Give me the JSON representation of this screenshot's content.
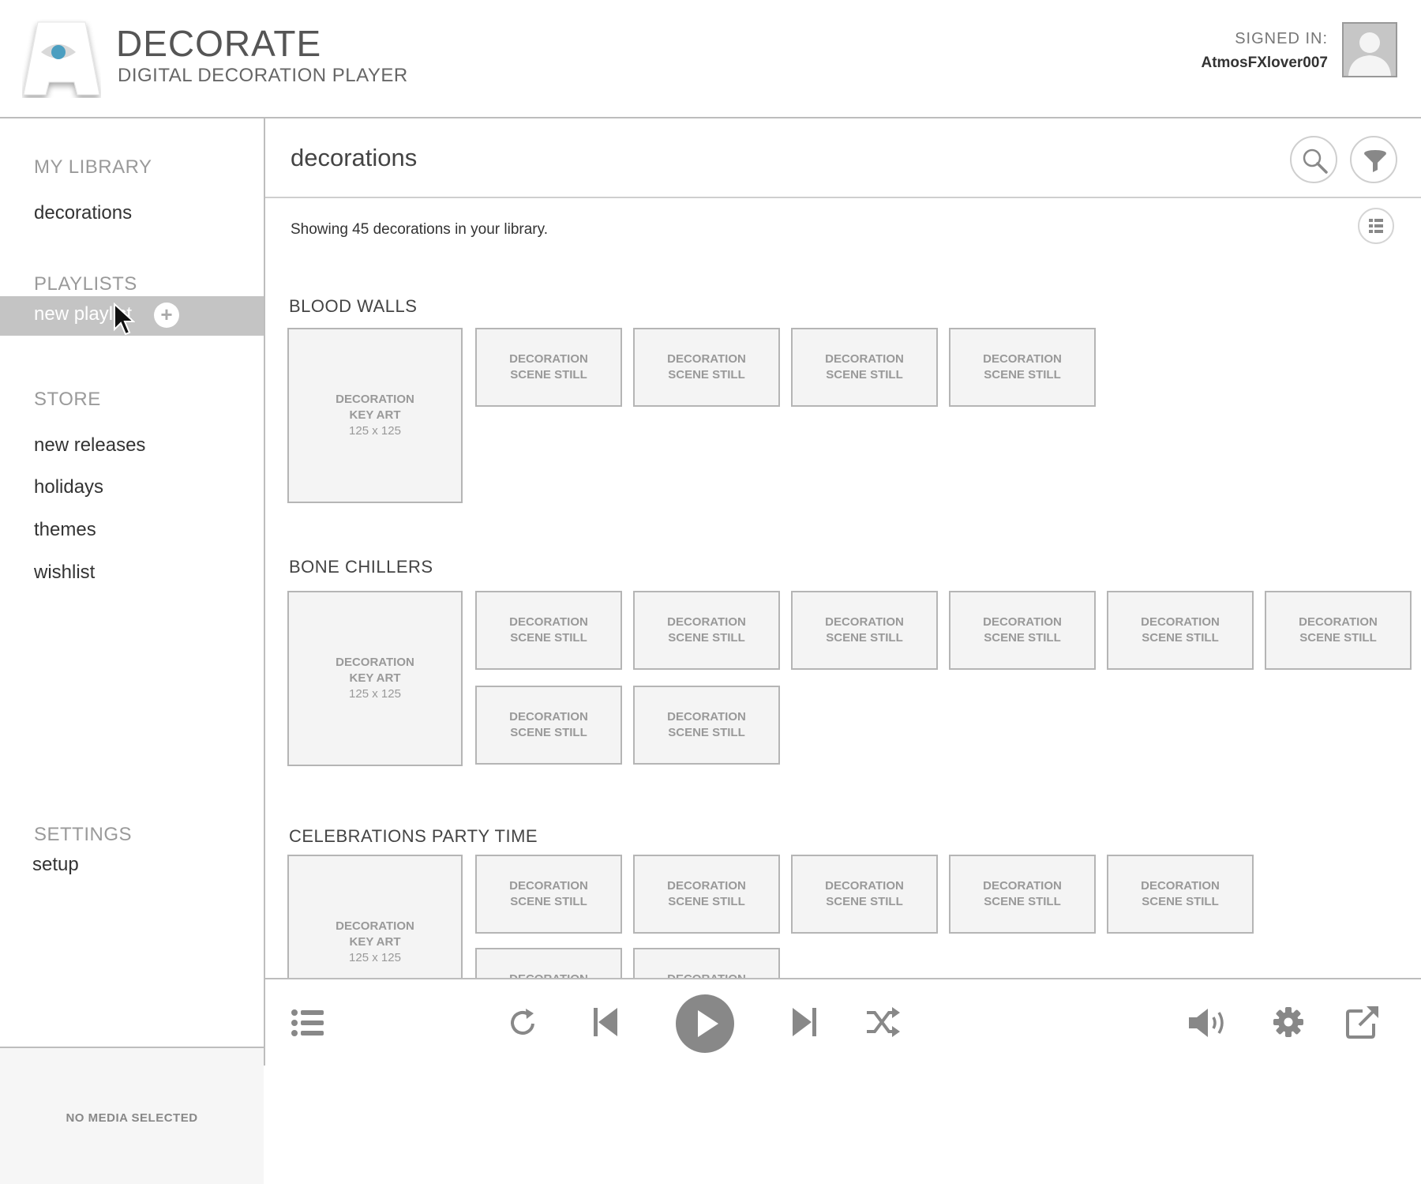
{
  "header": {
    "app_title": "DECORATE",
    "app_subtitle": "DIGITAL DECORATION PLAYER",
    "signed_in_label": "SIGNED IN:",
    "username": "AtmosFXlover007",
    "logo_icon": "eye-logo-icon",
    "accent_color": "#4b9ec0"
  },
  "sidebar": {
    "library_heading": "MY LIBRARY",
    "library_items": [
      "decorations"
    ],
    "playlists_heading": "PLAYLISTS",
    "playlist_items": [
      "new playlist"
    ],
    "store_heading": "STORE",
    "store_items": [
      "new releases",
      "holidays",
      "themes",
      "wishlist"
    ],
    "settings_heading": "SETTINGS",
    "settings_items": [
      "setup"
    ],
    "now_playing": "NO MEDIA SELECTED"
  },
  "main": {
    "title": "decorations",
    "count_text": "Showing 45 decorations in your library.",
    "sections": [
      {
        "title": "BLOOD WALLS",
        "key_art": {
          "line1": "DECORATION",
          "line2": "KEY ART",
          "size": "125 x 125"
        },
        "stills": [
          "DECORATION SCENE STILL",
          "DECORATION SCENE STILL",
          "DECORATION SCENE STILL",
          "DECORATION SCENE STILL"
        ]
      },
      {
        "title": "BONE CHILLERS",
        "key_art": {
          "line1": "DECORATION",
          "line2": "KEY ART",
          "size": "125 x 125"
        },
        "stills": [
          "DECORATION SCENE STILL",
          "DECORATION SCENE STILL",
          "DECORATION SCENE STILL",
          "DECORATION SCENE STILL",
          "DECORATION SCENE STILL",
          "DECORATION SCENE STILL",
          "DECORATION SCENE STILL",
          "DECORATION SCENE STILL"
        ]
      },
      {
        "title": "CELEBRATIONS PARTY TIME",
        "key_art": {
          "line1": "DECORATION",
          "line2": "KEY ART",
          "size": "125 x 125"
        },
        "stills": [
          "DECORATION SCENE STILL",
          "DECORATION SCENE STILL",
          "DECORATION SCENE STILL",
          "DECORATION SCENE STILL",
          "DECORATION SCENE STILL",
          "DECORATION SCENE STILL",
          "DECORATION SCENE STILL"
        ]
      }
    ]
  },
  "player": {
    "icons": [
      "queue-list-icon",
      "repeat-icon",
      "previous-icon",
      "play-icon",
      "next-icon",
      "shuffle-icon",
      "volume-icon",
      "settings-gear-icon",
      "external-output-icon"
    ]
  }
}
